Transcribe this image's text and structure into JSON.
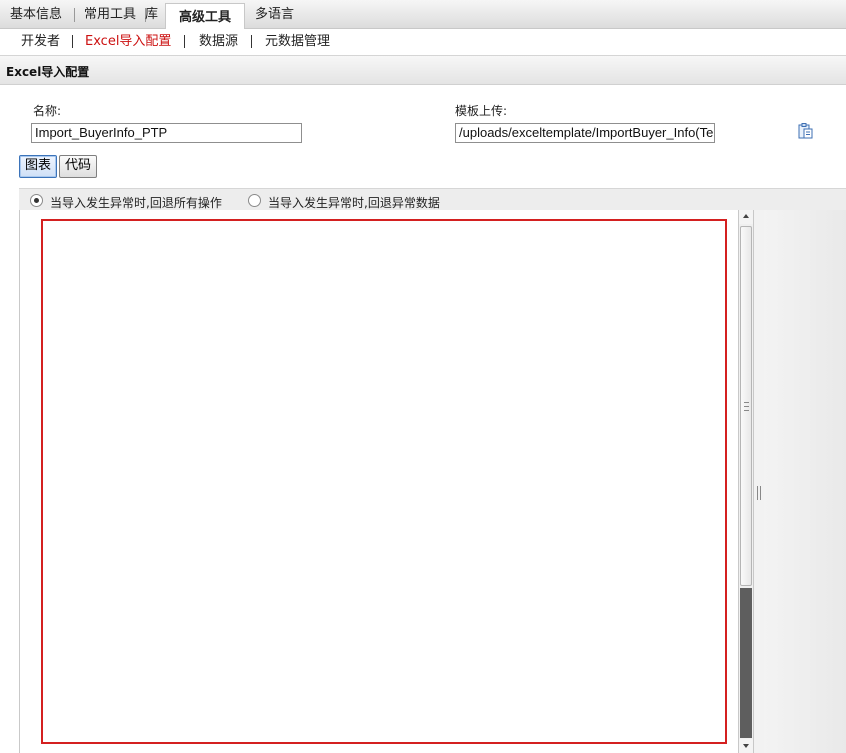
{
  "top_tabs": [
    {
      "label": "基本信息"
    },
    {
      "label": "常用工具"
    },
    {
      "label": "库"
    },
    {
      "label": "高级工具"
    },
    {
      "label": "多语言"
    }
  ],
  "sub_nav": [
    {
      "label": "开发者"
    },
    {
      "label": "Excel导入配置"
    },
    {
      "label": "数据源"
    },
    {
      "label": "元数据管理"
    }
  ],
  "section": {
    "title": "Excel导入配置"
  },
  "form": {
    "name_label": "名称:",
    "name_value": "Import_BuyerInfo_PTP",
    "template_label": "模板上传:",
    "template_value": "/uploads/exceltemplate/ImportBuyer_Info(Ter"
  },
  "view_buttons": {
    "chart": "图表",
    "code": "代码"
  },
  "options": {
    "rollback_all": "当导入发生异常时,回退所有操作",
    "rollback_error": "当导入发生异常时,回退异常数据"
  },
  "colors": {
    "active_nav": "#cc1111",
    "canvas_border": "#d42020"
  },
  "icons": {
    "upload": "paste-clipboard-icon"
  }
}
